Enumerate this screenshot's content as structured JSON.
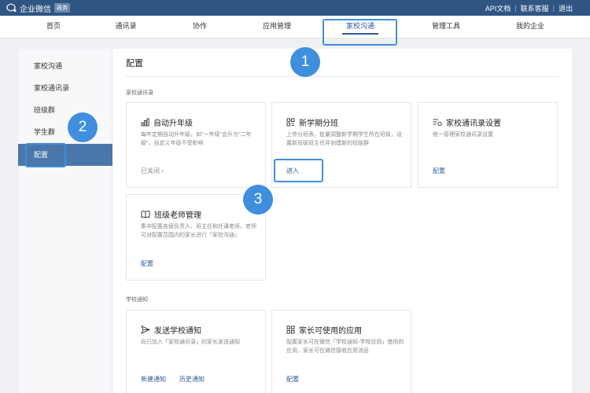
{
  "brand": {
    "name": "企业微信",
    "badge": "政务"
  },
  "top_links": [
    "API文档",
    "联系客服",
    "退出"
  ],
  "nav": [
    "首页",
    "通讯录",
    "协作",
    "应用管理",
    "家校沟通",
    "管理工具",
    "我的企业"
  ],
  "nav_active": "家校沟通",
  "sidebar": [
    "家校沟通",
    "家校通讯录",
    "班级群",
    "学生群",
    "配置"
  ],
  "sidebar_active": "配置",
  "page_title": "配置",
  "sections": [
    {
      "label": "家校通讯录",
      "cards": [
        {
          "icon": "bar-chart-icon",
          "title": "自动升年级",
          "desc": "每年定期自动升年级，如\"一年级\"会升为\"二年级\"，自定义年级不受影响",
          "links": [
            "已关闭 ›"
          ]
        },
        {
          "icon": "grid-icon",
          "title": "新学期分班",
          "desc": "上传分班表，批量调整新学期学生所在班级，设置新班级班主任并创建新的班级群",
          "links": [
            "进入"
          ]
        },
        {
          "icon": "settings-list-icon",
          "title": "家校通讯录设置",
          "desc": "统一管理家校通讯录设置",
          "links": [
            "配置"
          ]
        },
        {
          "icon": "book-icon",
          "title": "班级老师管理",
          "desc": "集中配置各级负责人、班主任和任课老师，老师可对配置范围内的家长进行「家校沟通」",
          "links": [
            "配置"
          ]
        }
      ]
    },
    {
      "label": "学校通知",
      "cards": [
        {
          "icon": "send-icon",
          "title": "发送学校通知",
          "desc": "向已加入「家校通讯录」的家长发送通知",
          "links": [
            "新建通知",
            "历史通知"
          ]
        },
        {
          "icon": "apps-icon",
          "title": "家长可使用的应用",
          "desc": "配置家长可在微信「学校通知-学校应用」使用的应用，家长可在微信接收应用消息",
          "links": [
            "配置"
          ]
        }
      ]
    }
  ],
  "callouts": [
    "1",
    "2",
    "3"
  ],
  "colors": {
    "topbar": "#2f5583",
    "accent": "#2b5b94",
    "sidebar_active": "#4a76aa",
    "callout": "#3f8fde"
  }
}
